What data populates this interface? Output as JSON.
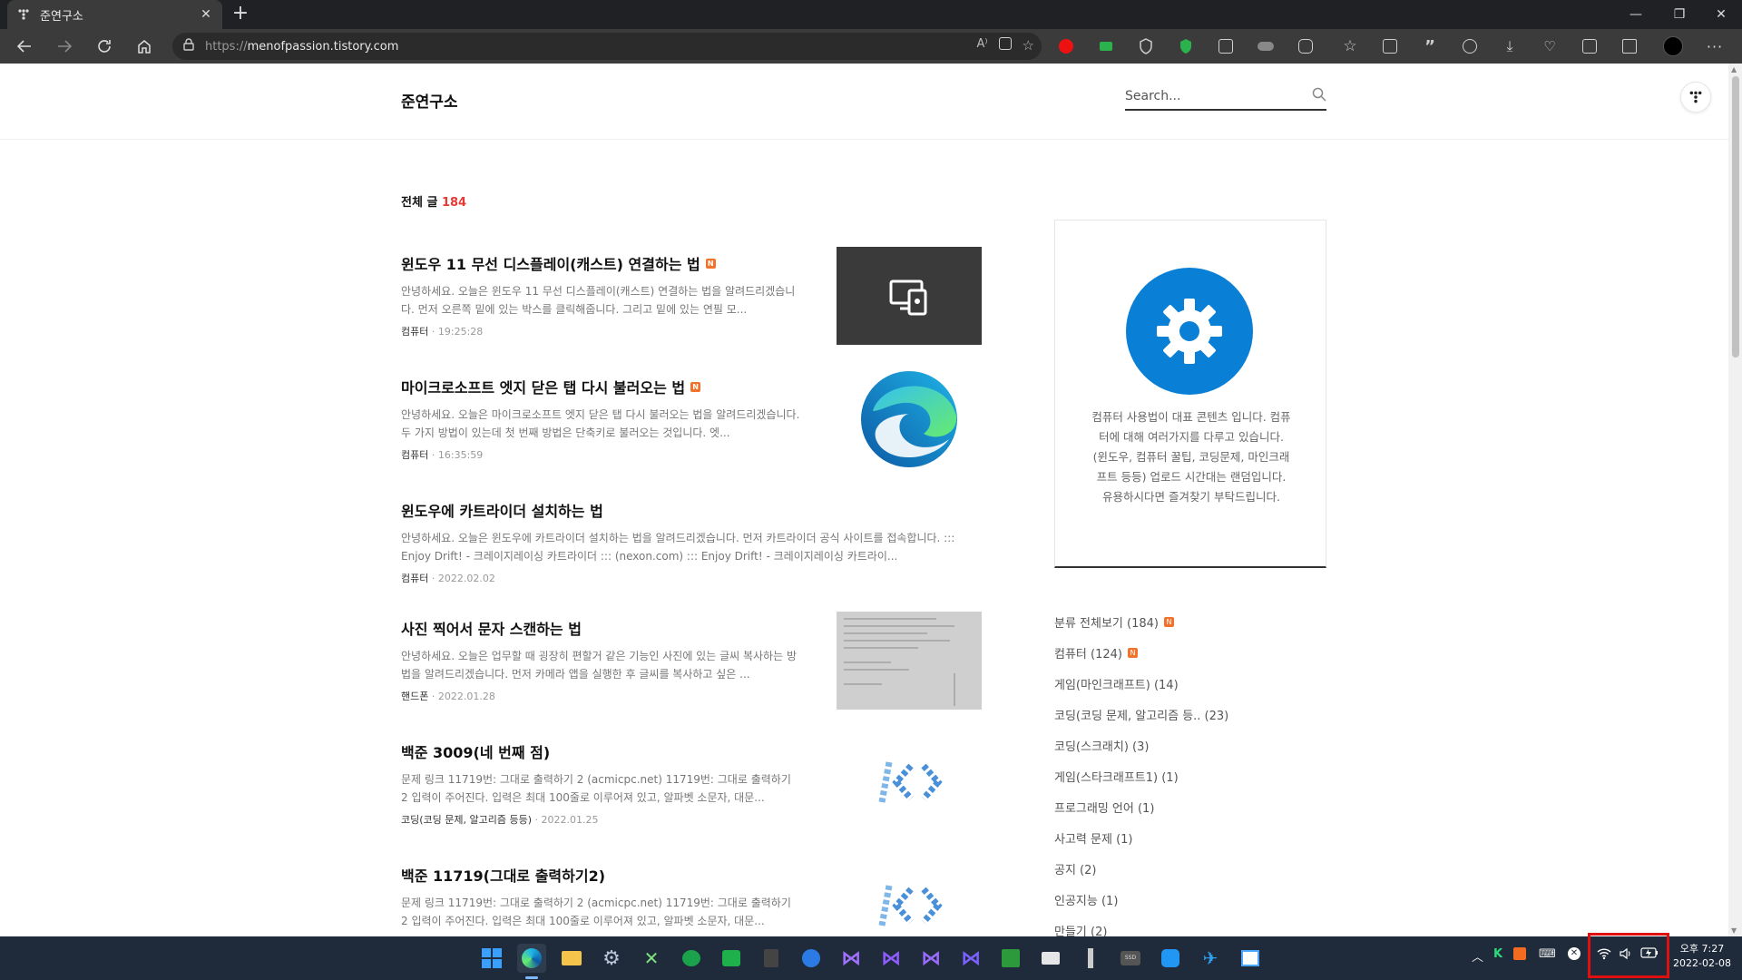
{
  "browser": {
    "tab_title": "준연구소",
    "url_protocol": "https://",
    "url_host": "menofpassion.tistory.com"
  },
  "blog": {
    "title": "준연구소",
    "search_placeholder": "Search...",
    "post_count_label": "전체 글",
    "post_count": "184"
  },
  "posts": [
    {
      "title": "윈도우 11 무선 디스플레이(캐스트) 연결하는 법",
      "excerpt": "안녕하세요. 오늘은 윈도우 11 무선 디스플레이(캐스트) 연결하는 법을 알려드리겠습니다. 먼저 오른쪽 밑에 있는 박스를 클릭해줍니다. 그리고 밑에 있는 연필 모...",
      "category": "컴퓨터",
      "date": "19:25:28",
      "new": "N"
    },
    {
      "title": "마이크로소프트 엣지 닫은 탭 다시 불러오는 법",
      "excerpt": "안녕하세요. 오늘은 마이크로소프트 엣지 닫은 탭 다시 불러오는 법을 알려드리겠습니다. 두 가지 방법이 있는데 첫 번째 방법은 단축키로 불러오는 것입니다. 엣...",
      "category": "컴퓨터",
      "date": "16:35:59",
      "new": "N"
    },
    {
      "title": "윈도우에 카트라이더 설치하는 법",
      "excerpt": "안녕하세요. 오늘은 윈도우에 카트라이더 설치하는 법을 알려드리겠습니다. 먼저 카트라이더 공식 사이트를 접속합니다. ::: Enjoy Drift! - 크레이지레이싱 카트라이더 ::: (nexon.com) ::: Enjoy Drift! - 크레이지레이싱 카트라이...",
      "category": "컴퓨터",
      "date": "2022.02.02"
    },
    {
      "title": "사진 찍어서 문자 스캔하는 법",
      "excerpt": "안녕하세요. 오늘은 업무할 때 굉장히 편할거 같은 기능인 사진에 있는 글씨 복사하는 방법을 알려드리겠습니다. 먼저 카메라 앱을 실행한 후 글씨를 복사하고 싶은 ...",
      "category": "핸드폰",
      "date": "2022.01.28"
    },
    {
      "title": "백준 3009(네 번째 점)",
      "excerpt": "문제 링크 11719번: 그대로 출력하기 2 (acmicpc.net) 11719번: 그대로 출력하기 2 입력이 주어진다. 입력은 최대 100줄로 이루어져 있고, 알파벳 소문자, 대문...",
      "category": "코딩(코딩 문제, 알고리즘 등등)",
      "date": "2022.01.25"
    },
    {
      "title": "백준 11719(그대로 출력하기2)",
      "excerpt": "문제 링크 11719번: 그대로 출력하기 2 (acmicpc.net) 11719번: 그대로 출력하기 2 입력이 주어진다. 입력은 최대 100줄로 이루어져 있고, 알파벳 소문자, 대문...",
      "category": "",
      "date": ""
    }
  ],
  "profile": {
    "description": "컴퓨터 사용법이 대표 콘텐츠 입니다. 컴퓨터에 대해 여러가지를 다루고 있습니다.(윈도우, 컴퓨터 꿀팁, 코딩문제, 마인크래프트 등등) 업로드 시간대는 랜덤입니다. 유용하시다면 즐겨찾기 부탁드립니다."
  },
  "categories": [
    {
      "label": "분류 전체보기 (184)",
      "new": "N"
    },
    {
      "label": "컴퓨터 (124)",
      "new": "N"
    },
    {
      "label": "게임(마인크래프트) (14)"
    },
    {
      "label": "코딩(코딩 문제, 알고리즘 등.. (23)"
    },
    {
      "label": "코딩(스크래치) (3)"
    },
    {
      "label": "게임(스타크래프트1) (1)"
    },
    {
      "label": "프로그래밍 언어 (1)"
    },
    {
      "label": "사고력 문제 (1)"
    },
    {
      "label": "공지 (2)"
    },
    {
      "label": "인공지능 (1)"
    },
    {
      "label": "만들기 (2)"
    }
  ],
  "taskbar": {
    "clock_time": "오후 7:27",
    "clock_date": "2022-02-08"
  },
  "colors": {
    "accent_red": "#e53935",
    "new_badge": "#f2722b",
    "profile_blue": "#0a7fd6"
  }
}
